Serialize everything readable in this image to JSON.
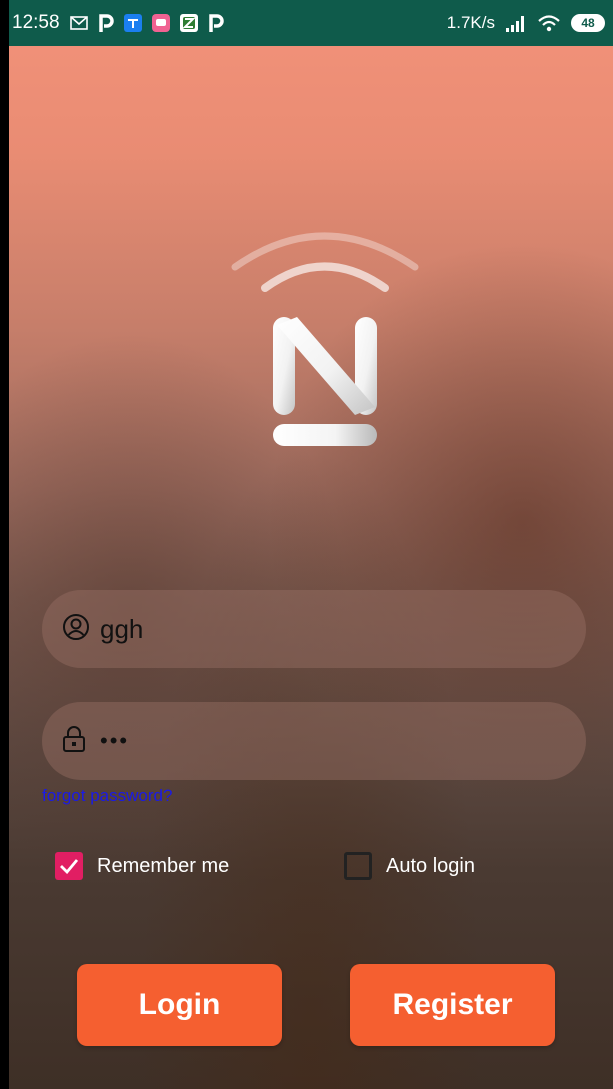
{
  "status_bar": {
    "time": "12:58",
    "net_speed": "1.7K/s",
    "battery": "48",
    "notification_icons": [
      "mail-icon",
      "p-app-icon",
      "zhihu-app-icon",
      "chat-app-icon",
      "z-app-icon",
      "p-app-icon"
    ]
  },
  "login_form": {
    "username_value": "ggh",
    "password_mask": "•••",
    "forgot_password_label": "forgot password?",
    "remember_me": {
      "label": "Remember me",
      "checked": true
    },
    "auto_login": {
      "label": "Auto login",
      "checked": false
    },
    "login_button_label": "Login",
    "register_button_label": "Register"
  },
  "colors": {
    "accent": "#f55f30",
    "checkbox_checked": "#e11e63",
    "link": "#1a1ae6",
    "status_bar": "#0f5b4b"
  }
}
